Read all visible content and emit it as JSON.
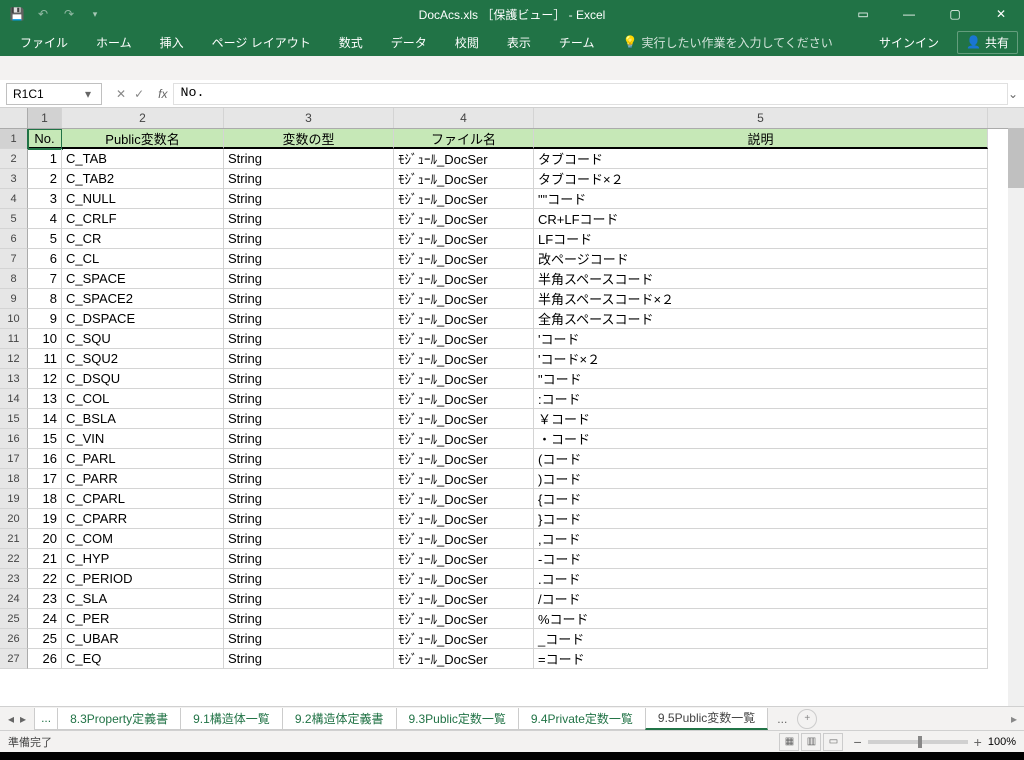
{
  "titlebar": {
    "title": "DocAcs.xls ［保護ビュー］ - Excel"
  },
  "qat": {
    "save": "💾",
    "undo": "↶",
    "redo": "↷",
    "dd": "▾"
  },
  "winctrls": {
    "ribbon": "▭",
    "min": "—",
    "max": "▢",
    "close": "✕"
  },
  "ribbon": {
    "tabs": [
      "ファイル",
      "ホーム",
      "挿入",
      "ページ レイアウト",
      "数式",
      "データ",
      "校閲",
      "表示",
      "チーム"
    ],
    "tell_icon": "💡",
    "tell": "実行したい作業を入力してください",
    "signin": "サインイン",
    "share": "共有",
    "share_icon": "👤"
  },
  "fbar": {
    "name": "R1C1",
    "cancel": "✕",
    "enter": "✓",
    "fx": "fx",
    "value": "No."
  },
  "col_headers": [
    "1",
    "2",
    "3",
    "4",
    "5"
  ],
  "table_headers": [
    "No.",
    "Public変数名",
    "変数の型",
    "ファイル名",
    "説明"
  ],
  "rows": [
    {
      "n": "1",
      "v": "C_TAB",
      "t": "String",
      "f": "ﾓｼﾞｭｰﾙ_DocSer",
      "d": "タブコード"
    },
    {
      "n": "2",
      "v": "C_TAB2",
      "t": "String",
      "f": "ﾓｼﾞｭｰﾙ_DocSer",
      "d": "タブコード×２"
    },
    {
      "n": "3",
      "v": "C_NULL",
      "t": "String",
      "f": "ﾓｼﾞｭｰﾙ_DocSer",
      "d": "\"\"コード"
    },
    {
      "n": "4",
      "v": "C_CRLF",
      "t": "String",
      "f": "ﾓｼﾞｭｰﾙ_DocSer",
      "d": "CR+LFコード"
    },
    {
      "n": "5",
      "v": "C_CR",
      "t": "String",
      "f": "ﾓｼﾞｭｰﾙ_DocSer",
      "d": "LFコード"
    },
    {
      "n": "6",
      "v": "C_CL",
      "t": "String",
      "f": "ﾓｼﾞｭｰﾙ_DocSer",
      "d": "改ページコード"
    },
    {
      "n": "7",
      "v": "C_SPACE",
      "t": "String",
      "f": "ﾓｼﾞｭｰﾙ_DocSer",
      "d": "半角スペースコード"
    },
    {
      "n": "8",
      "v": "C_SPACE2",
      "t": "String",
      "f": "ﾓｼﾞｭｰﾙ_DocSer",
      "d": "半角スペースコード×２"
    },
    {
      "n": "9",
      "v": "C_DSPACE",
      "t": "String",
      "f": "ﾓｼﾞｭｰﾙ_DocSer",
      "d": "全角スペースコード"
    },
    {
      "n": "10",
      "v": "C_SQU",
      "t": "String",
      "f": "ﾓｼﾞｭｰﾙ_DocSer",
      "d": "'コード"
    },
    {
      "n": "11",
      "v": "C_SQU2",
      "t": "String",
      "f": "ﾓｼﾞｭｰﾙ_DocSer",
      "d": "'コード×２"
    },
    {
      "n": "12",
      "v": "C_DSQU",
      "t": "String",
      "f": "ﾓｼﾞｭｰﾙ_DocSer",
      "d": "\"コード"
    },
    {
      "n": "13",
      "v": "C_COL",
      "t": "String",
      "f": "ﾓｼﾞｭｰﾙ_DocSer",
      "d": ":コード"
    },
    {
      "n": "14",
      "v": "C_BSLA",
      "t": "String",
      "f": "ﾓｼﾞｭｰﾙ_DocSer",
      "d": "￥コード"
    },
    {
      "n": "15",
      "v": "C_VIN",
      "t": "String",
      "f": "ﾓｼﾞｭｰﾙ_DocSer",
      "d": "・コード"
    },
    {
      "n": "16",
      "v": "C_PARL",
      "t": "String",
      "f": "ﾓｼﾞｭｰﾙ_DocSer",
      "d": "(コード"
    },
    {
      "n": "17",
      "v": "C_PARR",
      "t": "String",
      "f": "ﾓｼﾞｭｰﾙ_DocSer",
      "d": ")コード"
    },
    {
      "n": "18",
      "v": "C_CPARL",
      "t": "String",
      "f": "ﾓｼﾞｭｰﾙ_DocSer",
      "d": "{コード"
    },
    {
      "n": "19",
      "v": "C_CPARR",
      "t": "String",
      "f": "ﾓｼﾞｭｰﾙ_DocSer",
      "d": "}コード"
    },
    {
      "n": "20",
      "v": "C_COM",
      "t": "String",
      "f": "ﾓｼﾞｭｰﾙ_DocSer",
      "d": ",コード"
    },
    {
      "n": "21",
      "v": "C_HYP",
      "t": "String",
      "f": "ﾓｼﾞｭｰﾙ_DocSer",
      "d": " -コード"
    },
    {
      "n": "22",
      "v": "C_PERIOD",
      "t": "String",
      "f": "ﾓｼﾞｭｰﾙ_DocSer",
      "d": ".コード"
    },
    {
      "n": "23",
      "v": "C_SLA",
      "t": "String",
      "f": "ﾓｼﾞｭｰﾙ_DocSer",
      "d": "/コード"
    },
    {
      "n": "24",
      "v": "C_PER",
      "t": "String",
      "f": "ﾓｼﾞｭｰﾙ_DocSer",
      "d": "%コード"
    },
    {
      "n": "25",
      "v": "C_UBAR",
      "t": "String",
      "f": "ﾓｼﾞｭｰﾙ_DocSer",
      "d": "_コード"
    },
    {
      "n": "26",
      "v": "C_EQ",
      "t": "String",
      "f": "ﾓｼﾞｭｰﾙ_DocSer",
      "d": " =コード"
    }
  ],
  "sheets": {
    "ell": "...",
    "tabs": [
      "8.3Property定義書",
      "9.1構造体一覧",
      "9.2構造体定義書",
      "9.3Public定数一覧",
      "9.4Private定数一覧",
      "9.5Public変数一覧"
    ],
    "active": 5,
    "more": "...",
    "new_icon": "+"
  },
  "status": {
    "ready": "準備完了",
    "zoom": "100%"
  },
  "nav": {
    "first": "◂",
    "prev": "◂",
    "next": "▸",
    "dd": "▾"
  }
}
